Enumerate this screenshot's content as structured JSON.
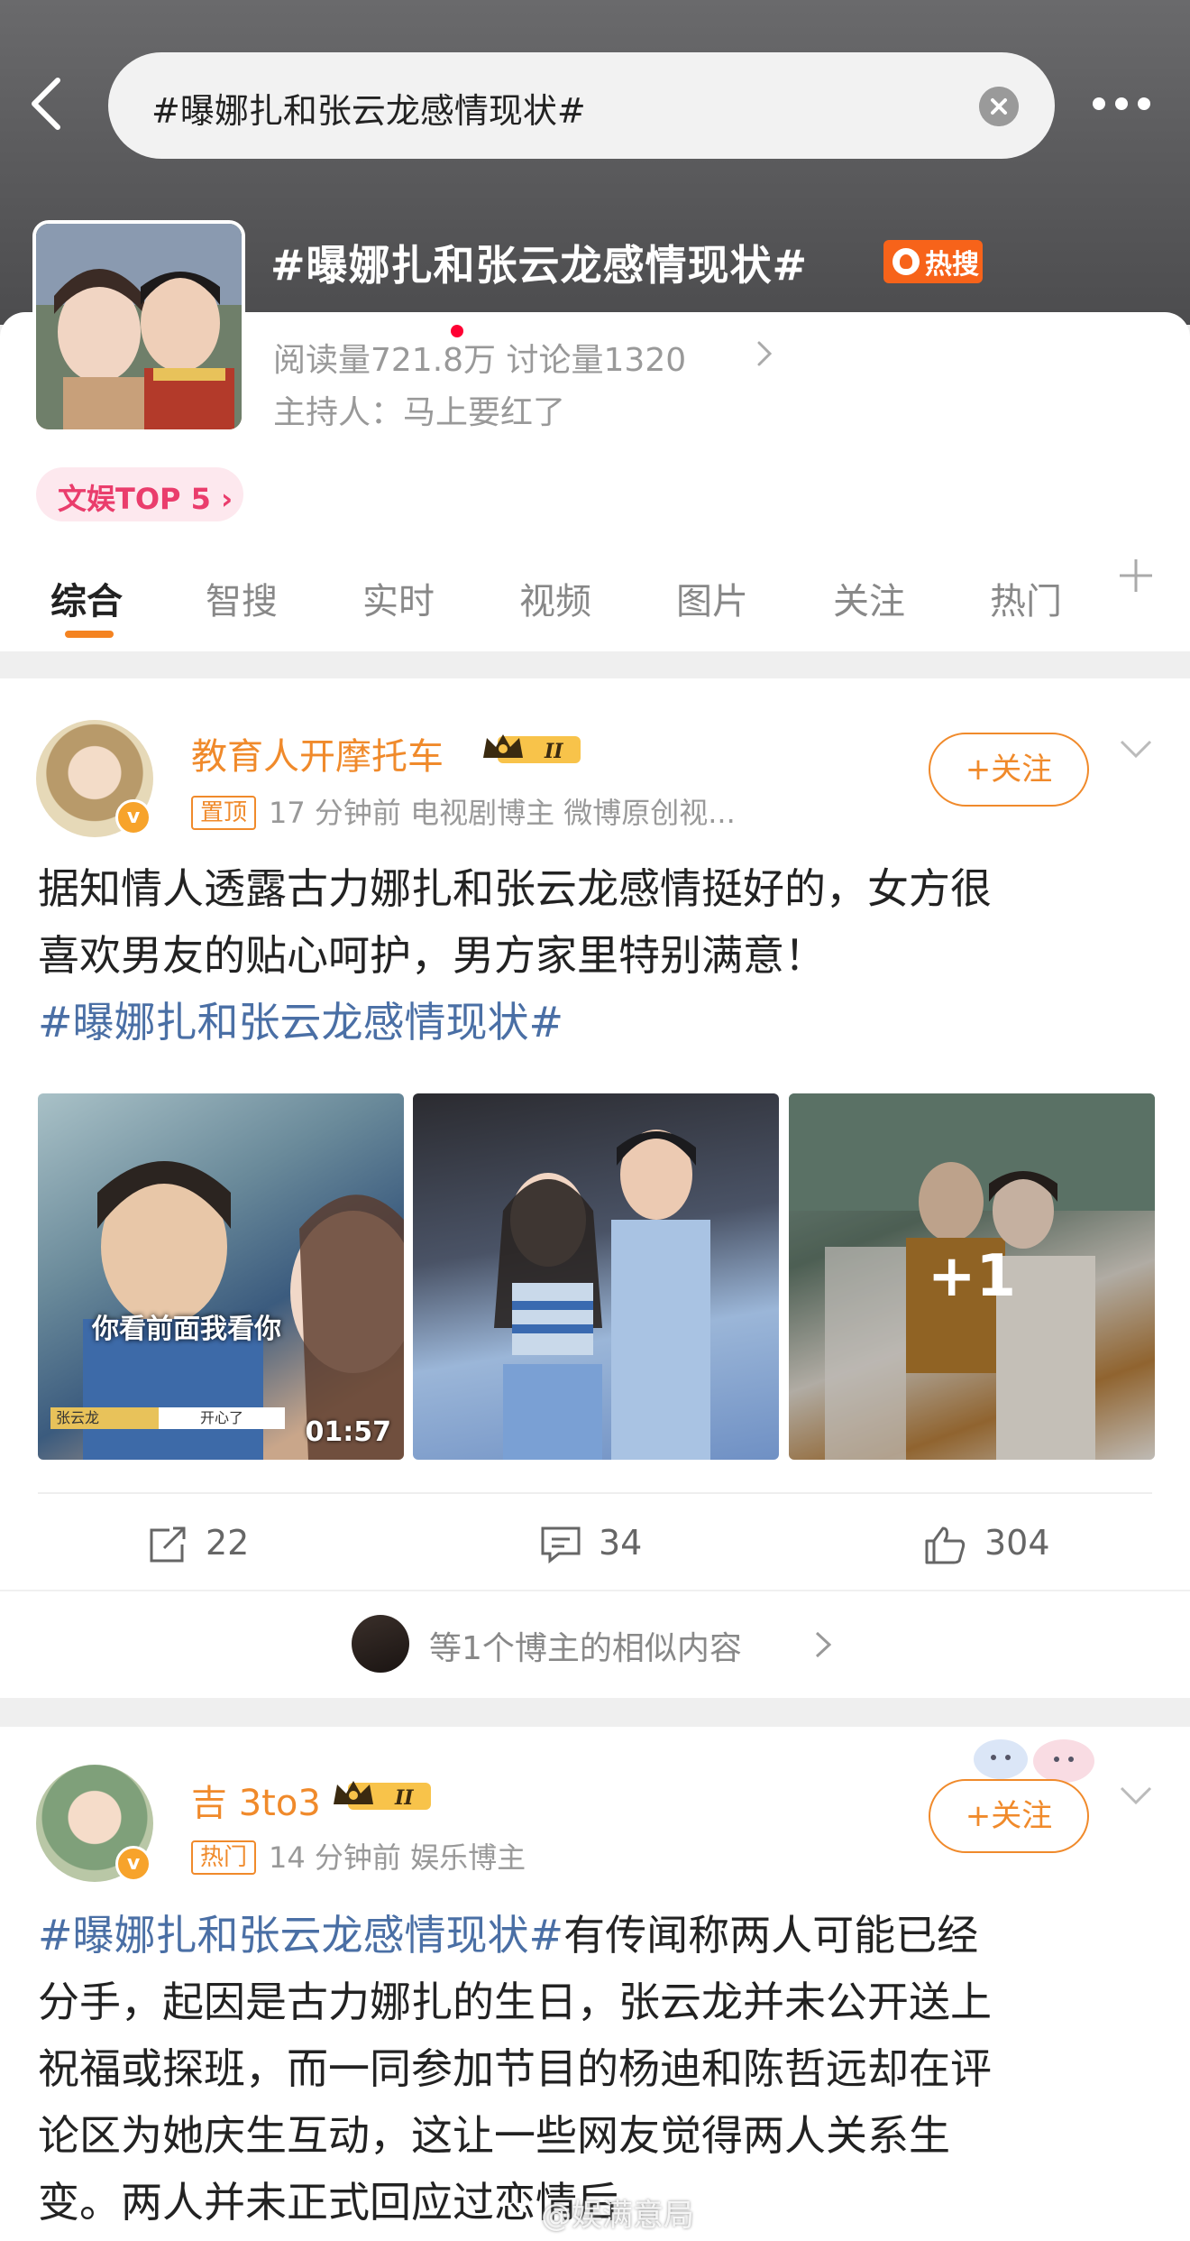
{
  "search": {
    "query": "#曝娜扎和张云龙感情现状#"
  },
  "topic": {
    "title": "#曝娜扎和张云龙感情现状#",
    "hot_badge": "热搜",
    "stats": "阅读量721.8万  讨论量1320",
    "host": "主持人：马上要红了",
    "rank": "文娱TOP 5"
  },
  "tabs": [
    {
      "label": "综合"
    },
    {
      "label": "智搜"
    },
    {
      "label": "实时"
    },
    {
      "label": "视频"
    },
    {
      "label": "图片"
    },
    {
      "label": "关注"
    },
    {
      "label": "热门"
    }
  ],
  "post1": {
    "username": "教育人开摩托车",
    "level": "II",
    "tag": "置顶",
    "meta": "17 分钟前   电视剧博主 微博原创视...",
    "follow": "+关注",
    "text_line1": "据知情人透露古力娜扎和张云龙感情挺好的，女方很",
    "text_line2": "喜欢男友的贴心呵护，男方家里特别满意！",
    "hashtag": "#曝娜扎和张云龙感情现状#",
    "thumb1_subtitle": "你看前面我看你",
    "thumb1_caption_left": "张云龙",
    "thumb1_caption_right": "开心了",
    "thumb1_duration": "01:57",
    "thumb3_more": "+1",
    "reposts": "22",
    "comments": "34",
    "likes": "304",
    "similar": "等1个博主的相似内容"
  },
  "post2": {
    "username": "吉 3to3",
    "level": "II",
    "tag": "热门",
    "meta": "14 分钟前   娱乐博主",
    "follow": "+关注",
    "hashtag": "#曝娜扎和张云龙感情现状#",
    "text_line1_rest": "有传闻称两人可能已经",
    "text_line2": "分手，起因是古力娜扎的生日，张云龙并未公开送上",
    "text_line3": "祝福或探班，而一同参加节目的杨迪和陈哲远却在评",
    "text_line4": "论区为她庆生互动，这让一些网友觉得两人关系生",
    "text_line5": "变。两人并未正式回应过恋情后"
  },
  "watermark": "@娱满意局",
  "colors": {
    "accent_orange": "#f08a2b",
    "hashtag_blue": "#4a6fa5",
    "hot_badge": "#f7631a",
    "rank_pink": "#ea3d6c"
  }
}
